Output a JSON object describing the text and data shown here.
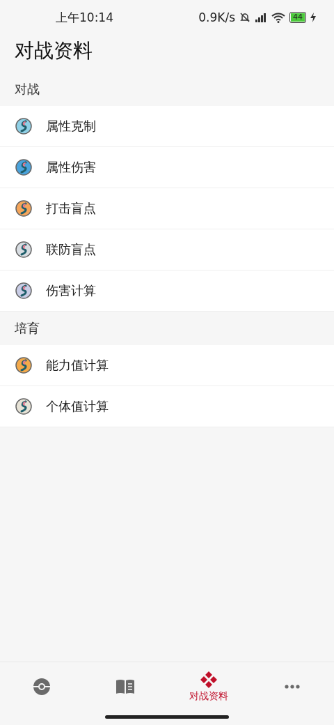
{
  "status_bar": {
    "time": "上午10:14",
    "speed": "0.9K/s",
    "battery": "44"
  },
  "title": "对战资料",
  "sections": [
    {
      "header": "对战",
      "items": [
        {
          "label": "属性克制",
          "color": "#8fd0e6"
        },
        {
          "label": "属性伤害",
          "color": "#4aa3dc"
        },
        {
          "label": "打击盲点",
          "color": "#f5a55a"
        },
        {
          "label": "联防盲点",
          "color": "#d8dde2"
        },
        {
          "label": "伤害计算",
          "color": "#c9cde6"
        }
      ]
    },
    {
      "header": "培育",
      "items": [
        {
          "label": "能力值计算",
          "color": "#f3a94a"
        },
        {
          "label": "个体值计算",
          "color": "#e6e2d6"
        }
      ]
    }
  ],
  "tabs": [
    {
      "kind": "ball",
      "selected": false
    },
    {
      "kind": "book",
      "selected": false
    },
    {
      "kind": "dpad",
      "selected": true,
      "label": "对战资料"
    },
    {
      "kind": "more",
      "selected": false
    }
  ]
}
